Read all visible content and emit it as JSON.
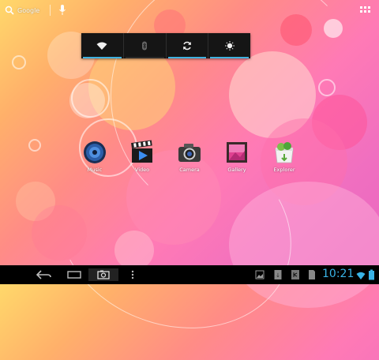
{
  "search": {
    "label": "Google"
  },
  "quick_settings": {
    "toggles": [
      {
        "id": "wifi",
        "icon": "wifi-icon",
        "active": true
      },
      {
        "id": "bluetooth",
        "icon": "bluetooth-icon",
        "active": false
      },
      {
        "id": "sync",
        "icon": "sync-icon",
        "active": true
      },
      {
        "id": "brightness",
        "icon": "brightness-icon",
        "active": true
      }
    ],
    "active_color": "#3fb0de",
    "inactive_color": "#2a2a2a"
  },
  "apps": [
    {
      "label": "Music",
      "icon": "music-icon"
    },
    {
      "label": "Video",
      "icon": "video-icon"
    },
    {
      "label": "Camera",
      "icon": "camera-icon"
    },
    {
      "label": "Gallery",
      "icon": "gallery-icon"
    },
    {
      "label": "Explorer",
      "icon": "explorer-icon"
    }
  ],
  "navbar": {
    "buttons": [
      "back-icon",
      "home-icon",
      "recent-apps-icon",
      "screenshot-icon",
      "menu-icon"
    ],
    "status_icons": [
      "gallery-notification-icon",
      "download-notification-icon",
      "usb-debug-icon",
      "sdcard-icon"
    ],
    "clock": "10:21",
    "accent": "#39b3e6"
  }
}
